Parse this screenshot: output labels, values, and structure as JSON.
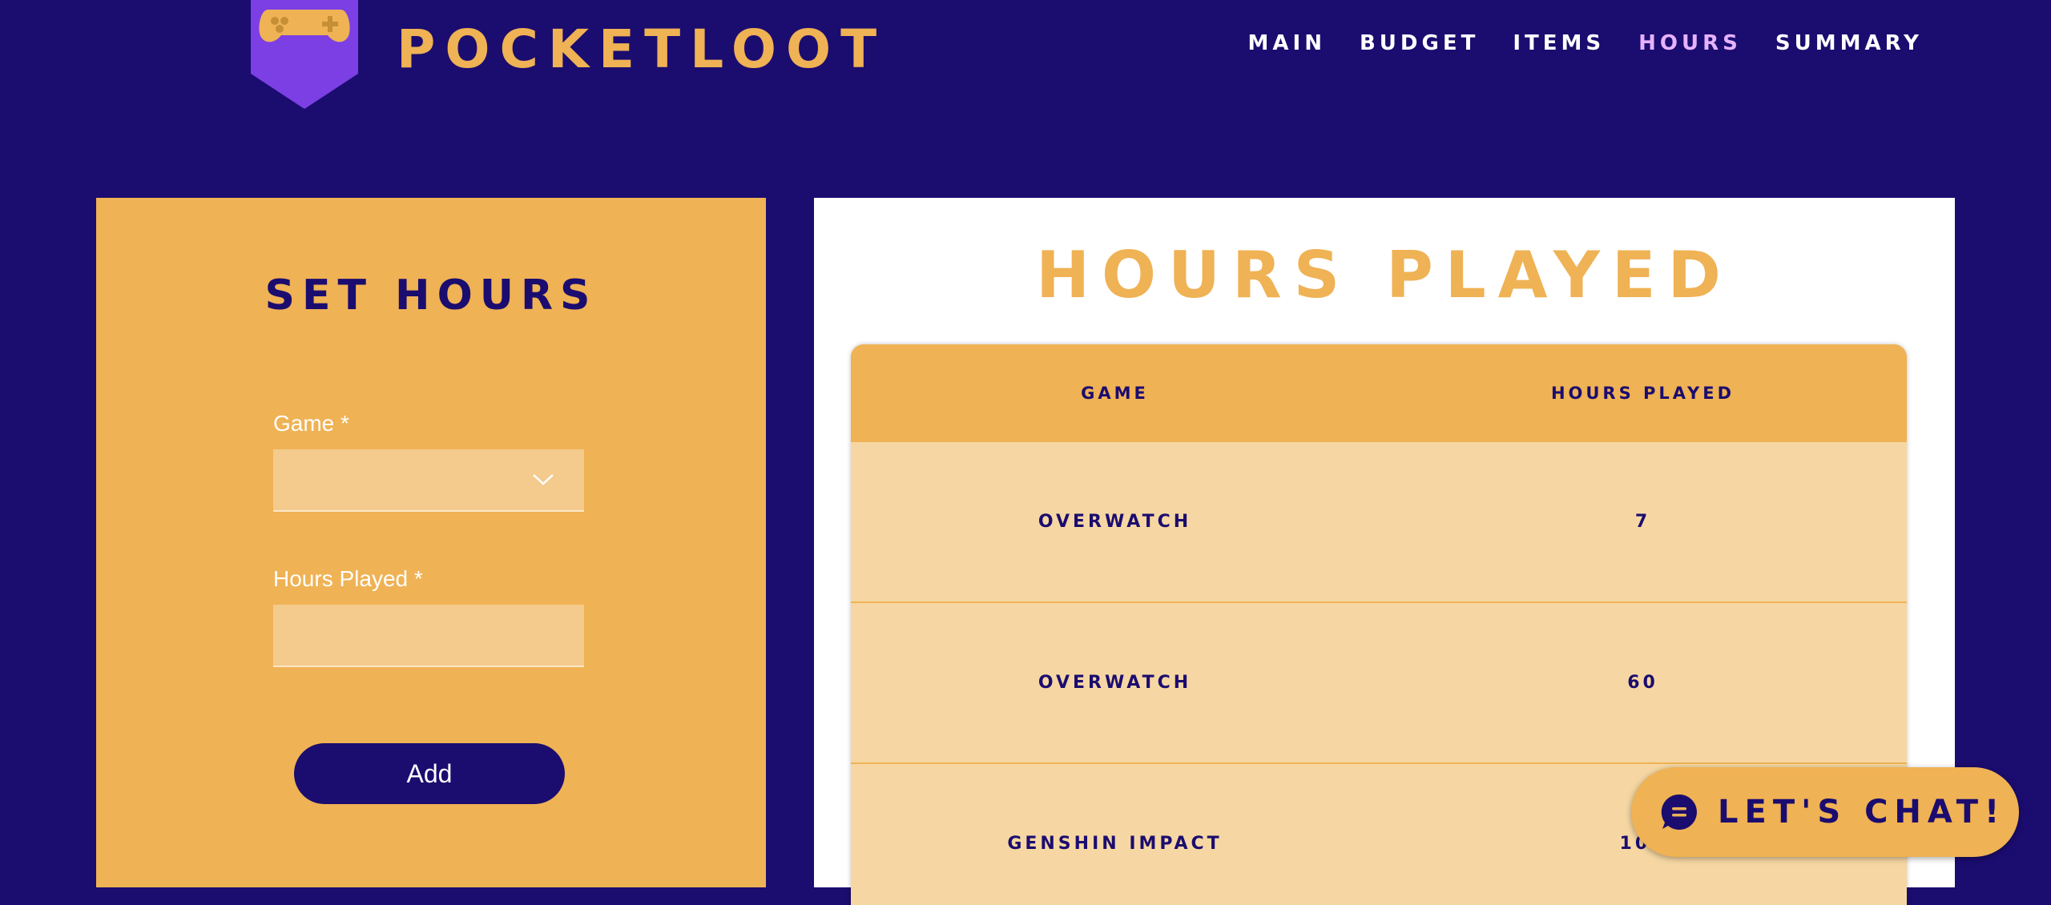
{
  "brand": {
    "name": "POCKETLOOT",
    "logo_icon": "gamepad-icon"
  },
  "nav": {
    "items": [
      {
        "label": "MAIN"
      },
      {
        "label": "BUDGET"
      },
      {
        "label": "ITEMS"
      },
      {
        "label": "HOURS",
        "active": true
      },
      {
        "label": "SUMMARY"
      }
    ]
  },
  "form": {
    "title": "SET HOURS",
    "game_label": "Game *",
    "game_value": "",
    "hours_label": "Hours Played *",
    "hours_value": "",
    "add_label": "Add"
  },
  "table": {
    "title": "HOURS PLAYED",
    "headers": [
      "GAME",
      "HOURS PLAYED"
    ],
    "rows": [
      {
        "game": "OVERWATCH",
        "hours": "7"
      },
      {
        "game": "OVERWATCH",
        "hours": "60"
      },
      {
        "game": "GENSHIN IMPACT",
        "hours": "100"
      }
    ]
  },
  "chat": {
    "label": "LET'S CHAT!",
    "icon": "chat-bubble-icon"
  },
  "colors": {
    "background": "#1b0c6f",
    "accent": "#efb254",
    "nav_active": "#e6b2ff",
    "logo_banner": "#7b3fe4"
  }
}
